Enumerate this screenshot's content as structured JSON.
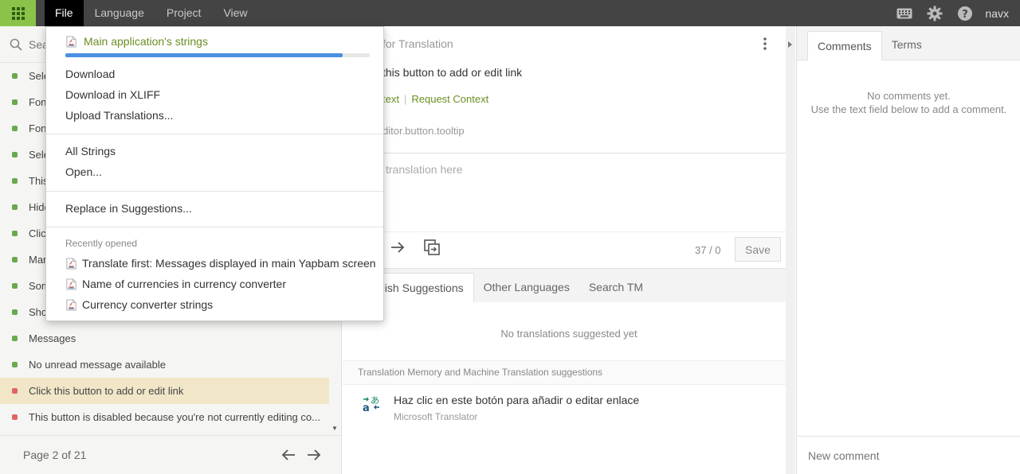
{
  "topbar": {
    "menus": [
      "File",
      "Language",
      "Project",
      "View"
    ],
    "username": "navx"
  },
  "left": {
    "search_placeholder": "Search",
    "items": [
      {
        "label": "Sele",
        "status": "done"
      },
      {
        "label": "Fon",
        "status": "done"
      },
      {
        "label": "Fon",
        "status": "done"
      },
      {
        "label": "Sele",
        "status": "done"
      },
      {
        "label": "This",
        "status": "done"
      },
      {
        "label": "Hide",
        "status": "done"
      },
      {
        "label": "Click",
        "status": "done"
      },
      {
        "label": "Mar",
        "status": "done"
      },
      {
        "label": "Som",
        "status": "done"
      },
      {
        "label": "Sho",
        "status": "done"
      },
      {
        "label": "Messages",
        "status": "done"
      },
      {
        "label": "No unread message available",
        "status": "done"
      },
      {
        "label": "Click this button to add or edit link",
        "status": "untranslated",
        "selected": true
      },
      {
        "label": "This button is disabled because you're not currently editing co...",
        "status": "untranslated"
      }
    ],
    "pager": "Page 2 of 21"
  },
  "center": {
    "source_header": "for Translation",
    "source_text": "this button to add or edit link",
    "context_link": "text",
    "request_context": "Request Context",
    "key": "ditor.button.tooltip",
    "translation_placeholder": "translation here",
    "counter": "37 / 0",
    "save_label": "Save",
    "tabs": [
      "nish Suggestions",
      "Other Languages",
      "Search TM"
    ],
    "no_suggestions": "No translations suggested yet",
    "tm_header": "Translation Memory and Machine Translation suggestions",
    "tm_suggestion": {
      "text": "Haz clic en este botón para añadir o editar enlace",
      "source": "Microsoft Translator"
    }
  },
  "right": {
    "tabs": [
      "Comments",
      "Terms"
    ],
    "no_comments_line1": "No comments yet.",
    "no_comments_line2": "Use the text field below to add a comment.",
    "new_comment_placeholder": "New comment"
  },
  "dropdown": {
    "title": "Main application's strings",
    "progress": 0.91,
    "items_group1": [
      "Download",
      "Download in XLIFF",
      "Upload Translations..."
    ],
    "items_group2": [
      "All Strings",
      "Open..."
    ],
    "items_group3": [
      "Replace in Suggestions..."
    ],
    "recent_label": "Recently opened",
    "recent": [
      "Translate first: Messages displayed in main Yapbam screen",
      "Name of currencies in currency converter",
      "Currency converter strings"
    ]
  },
  "colors": {
    "accent_green": "#8bc34a",
    "topbar": "#444444",
    "link_green": "#6b8e23",
    "progress_blue": "#4a90e2",
    "selected_row": "#f1e7c8"
  }
}
